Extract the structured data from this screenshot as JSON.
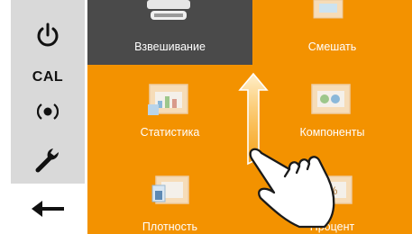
{
  "sidebar": {
    "power": {
      "icon": "power-icon"
    },
    "cal": {
      "label": "CAL"
    },
    "target": {
      "icon": "target-icon"
    },
    "service": {
      "icon": "wrench-icon"
    },
    "back": {
      "icon": "arrow-left-icon"
    }
  },
  "tiles": [
    {
      "label": "Взвешивание",
      "icon": "scale-icon",
      "active": true
    },
    {
      "label": "Смешать",
      "icon": "mix-icon",
      "active": false
    },
    {
      "label": "Статистика",
      "icon": "statistics-icon",
      "active": false
    },
    {
      "label": "Компоненты",
      "icon": "components-icon",
      "active": false
    },
    {
      "label": "Плотность",
      "icon": "density-icon",
      "active": false
    },
    {
      "label": "Процент",
      "icon": "percent-icon",
      "active": false
    }
  ],
  "gesture": {
    "type": "swipe-up",
    "icon": "hand-swipe-icon"
  },
  "colors": {
    "accent": "#f39200",
    "sidebar": "#d9d9d9",
    "active_tile": "#4a4a4a",
    "label": "#ffffff"
  }
}
